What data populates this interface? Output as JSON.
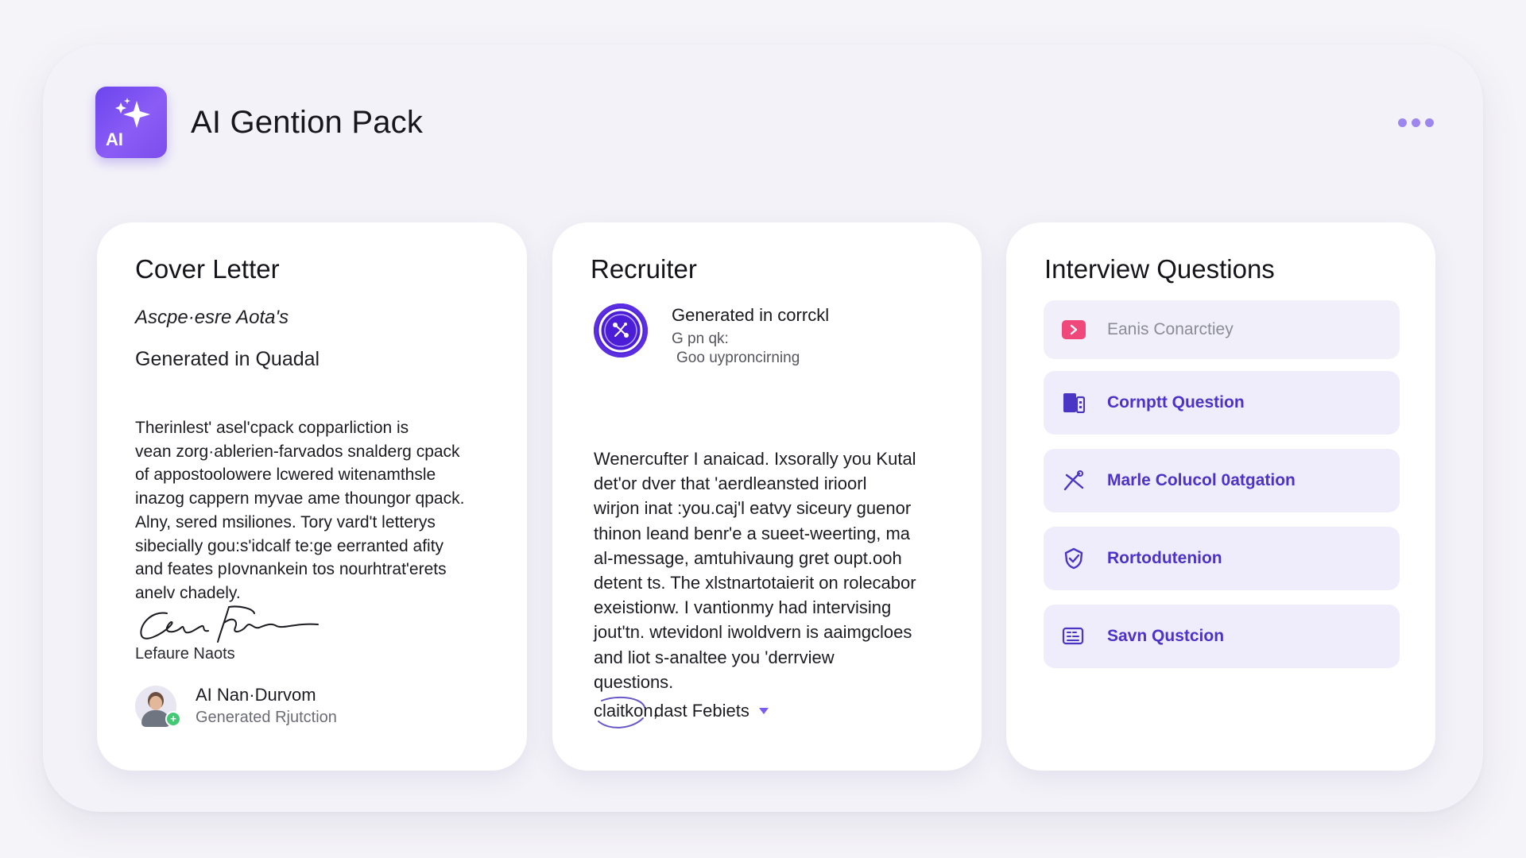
{
  "app": {
    "title": "AI Gention Pack",
    "logo_text": "AI"
  },
  "cover_letter": {
    "title": "Cover Letter",
    "subtitle": "Ascpe·esre Aota's",
    "generated": "Generated in Quadal",
    "body": "Therinlest' asel'cpack copparliction is\nvean zorg·ablerien-farvados snalderg cpack\nof appostoolowere lcwered witenamthsle\ninazog cappern myvae ame thoungor qpack.\nAlny, sered msiliones. Tory vard't letterys\nsibecially gou:s'idcalf te:ge eerranted afity\nand feates pIovnankein tos nourhtrat'erets\nanelv chadely.",
    "signature_name": "Lefaure Naots",
    "author_name": "AI Nan·Durvom",
    "author_role": "Generated Rjutction",
    "status_mark": "+"
  },
  "recruiter": {
    "title": "Recruiter",
    "head_title": "Generated in corrckl",
    "head_sub": "G pn qk:",
    "head_sub2": "Goo uyproncirning",
    "body": "Wenercufter I anaicad. Ixsorally you Kutal\ndet'or dver that 'aerdleansted irioorl\nwirjon inat :you.caj'l eatvy siceury guenor\nthinon leand benr'e a sueet-weerting, ma\nal-message, amtuhivaung gret oupt.ooh\ndetent ts. The xlstnartotaierit on rolecabor\nexeistionw. I vantionmy had intervising\njout'tn. wtevidonl iwoldvern is aaimgcloes\nand liot s-analtee you 'derrview\nquestions.",
    "footer_icon_text": "claitkon,",
    "footer_label": "dast Febiets"
  },
  "interview": {
    "title": "Interview Questions",
    "items": [
      {
        "label": "Eanis Conarctiey",
        "icon": "play-icon",
        "color": "#f0487a"
      },
      {
        "label": "Cornptt Question",
        "icon": "document-icon",
        "color": "#4a35c5"
      },
      {
        "label": "Marle Colucol 0atgation",
        "icon": "tools-icon",
        "color": "#4a35c5"
      },
      {
        "label": "Rortodutenion",
        "icon": "badge-check-icon",
        "color": "#4a35c5"
      },
      {
        "label": "Savn Qustcion",
        "icon": "keyboard-icon",
        "color": "#4a35c5"
      }
    ]
  },
  "colors": {
    "accent": "#6b45ee",
    "accent_text": "#4d32c8",
    "item_bg": "#efedfb"
  }
}
